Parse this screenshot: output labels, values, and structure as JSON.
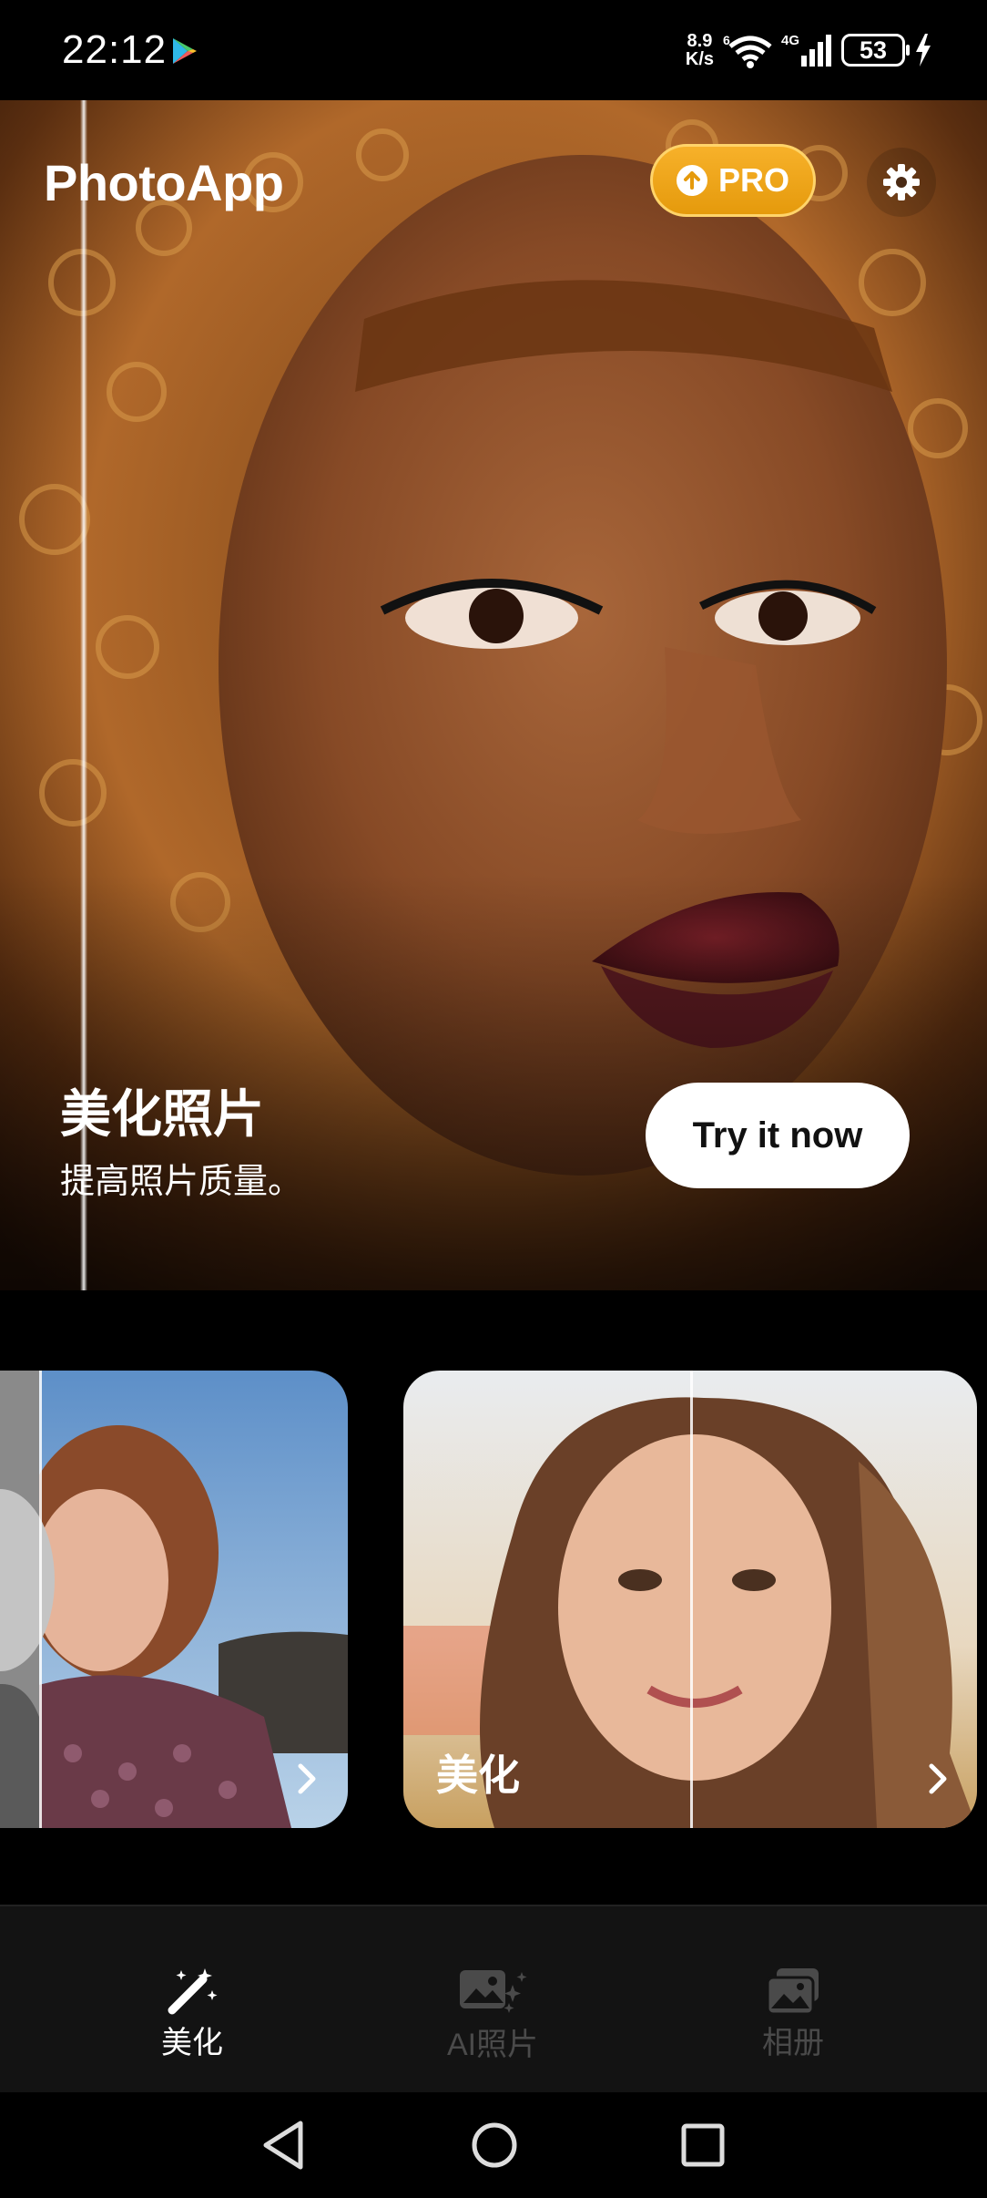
{
  "status_bar": {
    "time": "22:12",
    "net_speed_value": "8.9",
    "net_speed_unit": "K/s",
    "network_type": "4G",
    "battery": "53"
  },
  "header": {
    "app_title": "PhotoApp",
    "pro_label": "PRO"
  },
  "hero": {
    "title": "美化照片",
    "subtitle": "提高照片质量。",
    "cta_label": "Try it now"
  },
  "cards": [
    {
      "label": ""
    },
    {
      "label": "美化"
    }
  ],
  "bottom_nav": {
    "items": [
      {
        "label": "美化",
        "icon": "magic-wand-icon",
        "active": true
      },
      {
        "label": "AI照片",
        "icon": "ai-photo-icon",
        "active": false
      },
      {
        "label": "相册",
        "icon": "gallery-icon",
        "active": false
      }
    ]
  },
  "colors": {
    "pro_accent": "#F2A516",
    "nav_background": "#131313",
    "active_nav": "#FFFFFF",
    "inactive_nav": "#4A4A4A"
  }
}
